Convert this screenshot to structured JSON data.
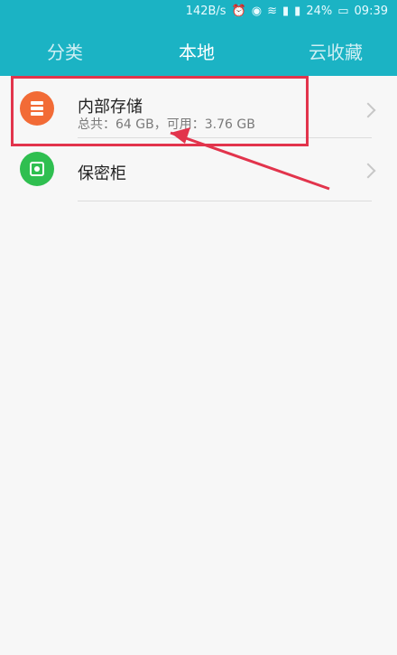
{
  "status": {
    "speed": "142B/s",
    "battery": "24%",
    "time": "09:39",
    "icons": [
      "alarm-icon",
      "eye-icon",
      "wifi-icon",
      "signal-icon",
      "signal-icon",
      "battery-icon"
    ]
  },
  "tabs": {
    "left": "分类",
    "center": "本地",
    "right": "云收藏",
    "active": "本地"
  },
  "items": [
    {
      "title": "内部存储",
      "subtitle": "总共：64 GB，可用：3.76 GB",
      "icon": "storage-icon",
      "color": "#f26b36"
    },
    {
      "title": "保密柜",
      "icon": "safe-icon",
      "color": "#2fbf50"
    }
  ],
  "colors": {
    "header": "#1bb3c4",
    "highlight": "#e2344c"
  }
}
